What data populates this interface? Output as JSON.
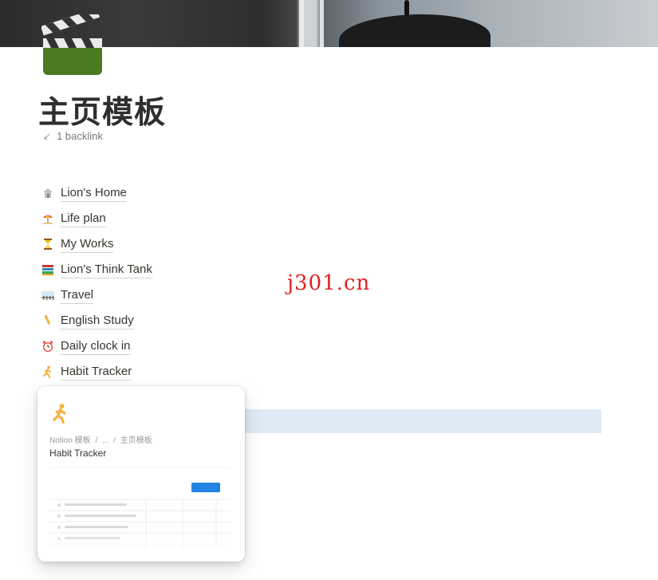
{
  "page": {
    "title": "主页模板",
    "icon": "clapperboard-icon",
    "backlink_text": "1 backlink"
  },
  "links": [
    {
      "label": "Lion's Home",
      "icon": "house-icon"
    },
    {
      "label": "Life plan",
      "icon": "umbrella-beach-icon"
    },
    {
      "label": "My Works",
      "icon": "hourglass-icon"
    },
    {
      "label": "Lion's Think Tank",
      "icon": "books-icon"
    },
    {
      "label": "Travel",
      "icon": "railway-track-icon"
    },
    {
      "label": "English Study",
      "icon": "pencil-icon"
    },
    {
      "label": "Daily clock in",
      "icon": "alarm-clock-icon"
    },
    {
      "label": "Habit Tracker",
      "icon": "running-person-icon"
    }
  ],
  "watermark": "j301.cn",
  "preview": {
    "icon": "running-person-icon",
    "breadcrumb": [
      "Notion 模板",
      "/",
      "...",
      "/",
      "主页模板"
    ],
    "title": "Habit Tracker"
  },
  "colors": {
    "text": "#37352f",
    "muted": "#787774",
    "watermark": "#e02020",
    "highlight": "#dfeaf5",
    "button_blue": "#2383e2"
  }
}
